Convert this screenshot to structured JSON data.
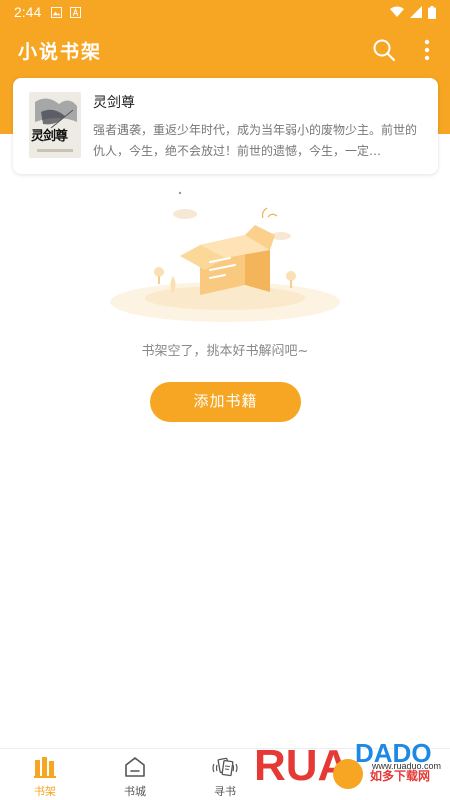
{
  "status_bar": {
    "time": "2:44",
    "icons": [
      "image-icon",
      "font-icon"
    ],
    "right_icons": [
      "wifi-icon",
      "signal-icon",
      "battery-icon"
    ]
  },
  "header": {
    "title": "小说书架",
    "actions": [
      "search-icon",
      "more-vert-icon"
    ]
  },
  "book": {
    "title": "灵剑尊",
    "description": "强者遇袭，重返少年时代，成为当年弱小的废物少主。前世的仇人，今生，绝不会放过！前世的遗憾，今生，一定…",
    "cover_text": "灵剑尊"
  },
  "empty_state": {
    "message": "书架空了，挑本好书解闷吧~",
    "button_label": "添加书籍"
  },
  "bottom_nav": {
    "items": [
      {
        "label": "书架",
        "icon": "bookshelf-icon",
        "active": true
      },
      {
        "label": "书城",
        "icon": "store-icon",
        "active": false
      },
      {
        "label": "寻书",
        "icon": "find-book-icon",
        "active": false
      }
    ]
  },
  "watermark": {
    "brand": "RUANDADO",
    "tagline": "如多下载网",
    "url": "www.ruaduo.com"
  },
  "colors": {
    "accent": "#f6a623",
    "text_primary": "#222222",
    "text_secondary": "#777777"
  }
}
